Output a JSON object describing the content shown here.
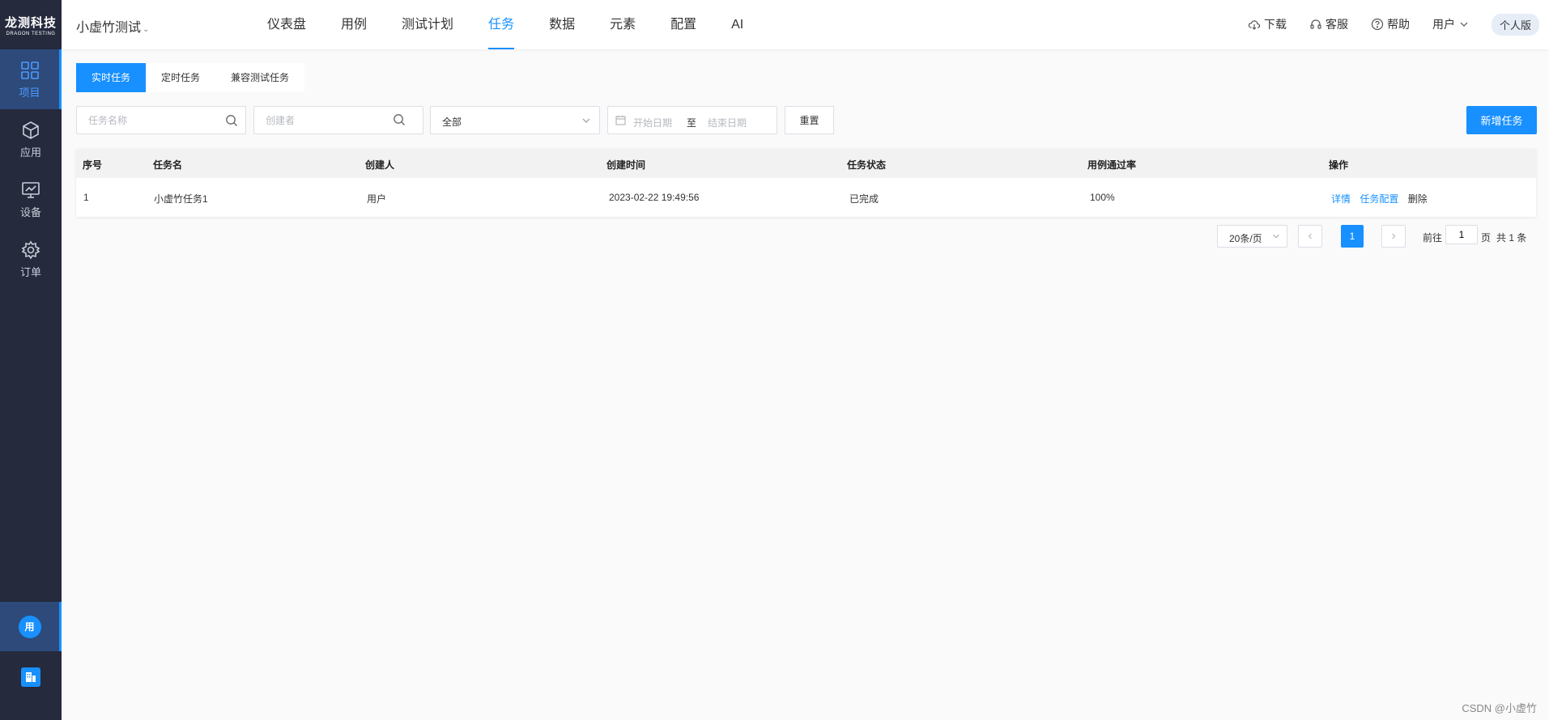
{
  "sidebar": {
    "logo_cn": "龙测科技",
    "logo_en": "DRAGON TESTING",
    "items": [
      {
        "label": "项目"
      },
      {
        "label": "应用"
      },
      {
        "label": "设备"
      },
      {
        "label": "订单"
      }
    ],
    "user_avatar": "用"
  },
  "topbar": {
    "project_name": "小虚竹测试",
    "nav": [
      {
        "label": "仪表盘"
      },
      {
        "label": "用例"
      },
      {
        "label": "测试计划"
      },
      {
        "label": "任务"
      },
      {
        "label": "数据"
      },
      {
        "label": "元素"
      },
      {
        "label": "配置"
      },
      {
        "label": "AI"
      }
    ],
    "download": "下载",
    "service": "客服",
    "help": "帮助",
    "user": "用户",
    "plan": "个人版"
  },
  "tabs": [
    {
      "label": "实时任务"
    },
    {
      "label": "定时任务"
    },
    {
      "label": "兼容测试任务"
    }
  ],
  "filters": {
    "task_name_placeholder": "任务名称",
    "creator_placeholder": "创建者",
    "status_value": "全部",
    "start_date_placeholder": "开始日期",
    "date_separator": "至",
    "end_date_placeholder": "结束日期",
    "reset_label": "重置",
    "add_label": "新增任务"
  },
  "table": {
    "headers": [
      "序号",
      "任务名",
      "创建人",
      "创建时间",
      "任务状态",
      "用例通过率",
      "操作"
    ],
    "rows": [
      {
        "index": "1",
        "name": "小虚竹任务1",
        "creator": "用户",
        "created_at": "2023-02-22 19:49:56",
        "status": "已完成",
        "pass_rate": "100%",
        "ops": [
          "详情",
          "任务配置",
          "删除"
        ]
      }
    ]
  },
  "pagination": {
    "page_size": "20条/页",
    "current_page": "1",
    "goto_prefix": "前往",
    "goto_value": "1",
    "goto_suffix": "页",
    "total": "共 1 条"
  },
  "watermark": "CSDN @小虚竹",
  "colors": {
    "accent": "#1890ff",
    "sidebar_bg": "#252a3d",
    "sidebar_active_bg": "#2d4a7a"
  }
}
